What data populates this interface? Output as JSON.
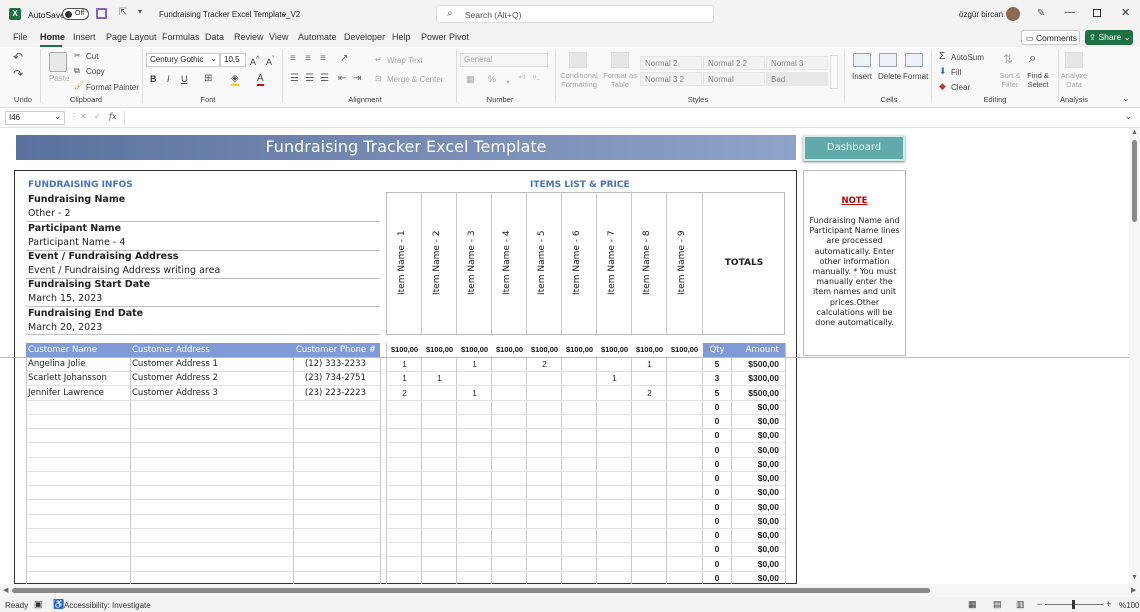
{
  "titlebar": {
    "autosave_label": "AutoSave",
    "autosave_state": "Off",
    "doc_title": "Fundraising Tracker Excel Template_V2",
    "search_placeholder": "Search (Alt+Q)",
    "user_name": "özgür bircan"
  },
  "menu_tabs": [
    "File",
    "Home",
    "Insert",
    "Page Layout",
    "Formulas",
    "Data",
    "Review",
    "View",
    "Automate",
    "Developer",
    "Help",
    "Power Pivot"
  ],
  "comments_label": "Comments",
  "share_label": "Share",
  "ribbon": {
    "clipboard": {
      "paste": "Paste",
      "cut": "Cut",
      "copy": "Copy",
      "format_painter": "Format Painter",
      "group": "Clipboard"
    },
    "undo_group": "Undo",
    "font": {
      "name": "Century Gothic",
      "size": "10,5",
      "group": "Font"
    },
    "alignment": {
      "wrap": "Wrap Text",
      "merge": "Merge & Center",
      "group": "Alignment"
    },
    "number": {
      "format": "General",
      "group": "Number"
    },
    "styles": {
      "conditional": "Conditional Formatting",
      "format_table": "Format as Table",
      "normal2": "Normal 2",
      "normal22": "Normal 2 2",
      "normal3": "Normal 3",
      "normal32": "Normal 3 2",
      "normal": "Normal",
      "bad": "Bad",
      "group": "Styles"
    },
    "cells": {
      "insert": "Insert",
      "delete": "Delete",
      "format": "Format",
      "group": "Cells"
    },
    "editing": {
      "autosum": "AutoSum",
      "fill": "Fill",
      "clear": "Clear",
      "sort": "Sort & Filter",
      "find": "Find & Select",
      "group": "Editing"
    },
    "analysis": {
      "analyze": "Analyze Data",
      "group": "Analysis"
    }
  },
  "formula_bar": {
    "name_box": "I46",
    "fx": "fx",
    "value": ""
  },
  "sheet": {
    "banner_title": "Fundraising Tracker Excel Template",
    "dashboard_button": "Dashboard",
    "infos_header": "FUNDRAISING INFOS",
    "items_header": "ITEMS LIST & PRICE",
    "info_rows": [
      {
        "label": "Fundraising Name",
        "value": "Other - 2"
      },
      {
        "label": "Participant Name",
        "value": "Participant Name - 4"
      },
      {
        "label": "Event / Fundraising Address",
        "value": "Event / Fundraising Address writing area"
      },
      {
        "label": "Fundraising Start Date",
        "value": "March 15, 2023"
      },
      {
        "label": "Fundraising End Date",
        "value": "March 20, 2023"
      }
    ],
    "items": [
      "Item Name - 1",
      "Item Name - 2",
      "Item Name - 3",
      "Item Name - 4",
      "Item Name - 5",
      "Item Name - 6",
      "Item Name - 7",
      "Item Name - 8",
      "Item Name - 9"
    ],
    "prices": [
      "$100,00",
      "$100,00",
      "$100,00",
      "$100,00",
      "$100,00",
      "$100,00",
      "$100,00",
      "$100,00",
      "$100,00"
    ],
    "totals_label": "TOTALS",
    "col_headers": {
      "name": "Customer Name",
      "address": "Customer Address",
      "phone": "Customer Phone #",
      "qty": "Qty",
      "amount": "Amount"
    },
    "customers": [
      {
        "name": "Angelina Jolie",
        "address": "Customer Address 1",
        "phone": "(12) 333-2233",
        "q": [
          "1",
          "",
          "1",
          "",
          "2",
          "",
          "",
          "1",
          ""
        ],
        "qty": "5",
        "amount": "$500,00"
      },
      {
        "name": "Scarlett Johansson",
        "address": "Customer Address 2",
        "phone": "(23) 734-2751",
        "q": [
          "1",
          "1",
          "",
          "",
          "",
          "",
          "1",
          "",
          ""
        ],
        "qty": "3",
        "amount": "$300,00"
      },
      {
        "name": "Jennifer Lawrence",
        "address": "Customer Address 3",
        "phone": "(23) 223-2223",
        "q": [
          "2",
          "",
          "1",
          "",
          "",
          "",
          "",
          "2",
          ""
        ],
        "qty": "5",
        "amount": "$500,00"
      }
    ],
    "empty_totals": {
      "qty": "0",
      "amount": "$0,00"
    },
    "note_title": "NOTE",
    "note_text": "Fundraising Name and Participant Name lines are processed automatically. Enter other information manually. * You must manually enter the item names and unit prices.Other calculations will be done automatically."
  },
  "status": {
    "ready": "Ready",
    "accessibility": "Accessibility: Investigate",
    "zoom": "%100"
  },
  "colors": {
    "banner": "#6c84ae",
    "header_blue": "#4472c4",
    "table_header": "#7f9ad6",
    "dashboard": "#5fa8a8",
    "note_red": "#c00000",
    "excel_green": "#1e7145"
  }
}
